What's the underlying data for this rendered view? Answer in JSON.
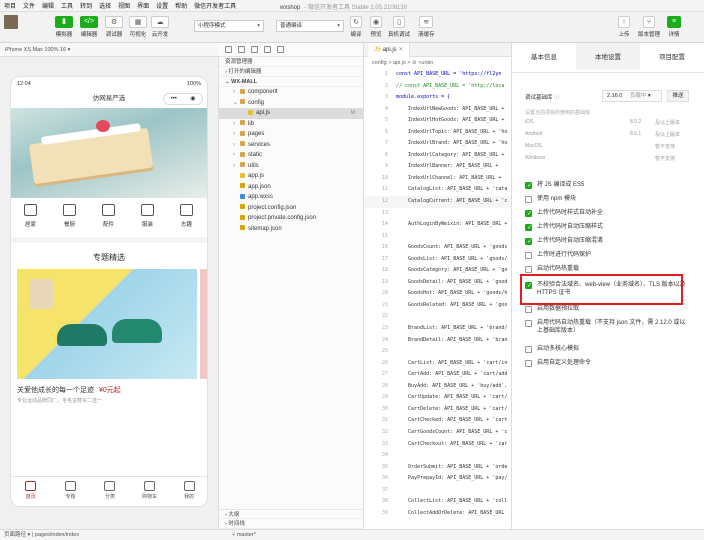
{
  "menu": [
    "项目",
    "文件",
    "编辑",
    "工具",
    "转到",
    "选择",
    "视图",
    "界面",
    "设置",
    "帮助",
    "微信开发者工具"
  ],
  "window_title": "wxshop",
  "window_subtitle": "- 微信开发者工具 Stable 1.05.2108130",
  "toolbar": {
    "simulator": "模拟器",
    "editor": "编辑器",
    "debugger": "调试器",
    "visual": "可视化",
    "cloud": "云开发",
    "mode": "小程序模式",
    "compile": "普通编译",
    "compile_btn": "编译",
    "preview": "预览",
    "real_debug": "真机调试",
    "clear_cache": "清缓存",
    "upload": "上传",
    "version": "版本管理",
    "details": "详情"
  },
  "sim": {
    "device": "iPhone XS Max 100% 16 ▾",
    "time": "12:04",
    "battery": "100%",
    "page_title": "仿网易严选",
    "capsule_dots": "•••",
    "capsule_target": "◉"
  },
  "categories": [
    "居家",
    "餐厨",
    "配件",
    "服装",
    "志趣"
  ],
  "topic": {
    "header": "专题精选",
    "title": "关爱他成长的每一个足迹",
    "price": "¥0元起",
    "desc": "专业运动品牌同厂，毛毛虫鞋买二送一"
  },
  "tabbar": [
    "首页",
    "专题",
    "分类",
    "购物车",
    "我的"
  ],
  "explorer": {
    "title": "资源管理器",
    "open_editors": "打开的编辑器",
    "project": "WX-MALL",
    "outline": "大纲",
    "timeline": "时间线",
    "items": [
      {
        "name": "component",
        "type": "folder",
        "indent": 1
      },
      {
        "name": "config",
        "type": "folder",
        "indent": 1
      },
      {
        "name": "api.js",
        "type": "js",
        "indent": 2,
        "badge": "M"
      },
      {
        "name": "lib",
        "type": "folder",
        "indent": 1
      },
      {
        "name": "pages",
        "type": "folder",
        "indent": 1
      },
      {
        "name": "services",
        "type": "folder",
        "indent": 1
      },
      {
        "name": "static",
        "type": "folder",
        "indent": 1
      },
      {
        "name": "utils",
        "type": "folder",
        "indent": 1
      },
      {
        "name": "app.js",
        "type": "js",
        "indent": 1
      },
      {
        "name": "app.json",
        "type": "json",
        "indent": 1
      },
      {
        "name": "app.wxss",
        "type": "wxss",
        "indent": 1
      },
      {
        "name": "project.config.json",
        "type": "json",
        "indent": 1
      },
      {
        "name": "project.private.config.json",
        "type": "json",
        "indent": 1
      },
      {
        "name": "sitemap.json",
        "type": "json",
        "indent": 1
      }
    ]
  },
  "editor": {
    "tab": "api.js",
    "breadcrumb": "config > api.js > ⊘ <unkn",
    "lines": [
      {
        "n": "1",
        "t": "const API_BASE_URL = 'https://fl2yn"
      },
      {
        "n": "2",
        "t": "// const API_BASE_URL = 'http://loca"
      },
      {
        "n": "3",
        "t": "module.exports = {"
      },
      {
        "n": "4",
        "t": "    IndexUrlNewGoods: API_BASE_URL +"
      },
      {
        "n": "5",
        "t": "    IndexUrlHotGoods: API_BASE_URL +"
      },
      {
        "n": "6",
        "t": "    IndexUrlTopic: API_BASE_URL + 'ho"
      },
      {
        "n": "7",
        "t": "    IndexUrlBrand: API_BASE_URL + 'ho"
      },
      {
        "n": "8",
        "t": "    IndexUrlCategory: API_BASE_URL +"
      },
      {
        "n": "9",
        "t": "    IndexUrlBanner: API_BASE_URL +"
      },
      {
        "n": "10",
        "t": "    IndexUrlChannel: API_BASE_URL +"
      },
      {
        "n": "11",
        "t": "    CatalogList: API_BASE_URL + 'cata"
      },
      {
        "n": "12",
        "t": "    CatalogCurrent: API_BASE_URL + 'c"
      },
      {
        "n": "13",
        "t": ""
      },
      {
        "n": "14",
        "t": "    AuthLoginByWeixin: API_BASE_URL +"
      },
      {
        "n": "15",
        "t": ""
      },
      {
        "n": "16",
        "t": "    GoodsCount: API_BASE_URL + 'goods"
      },
      {
        "n": "17",
        "t": "    GoodsList: API_BASE_URL + 'goods/"
      },
      {
        "n": "18",
        "t": "    GoodsCategory: API_BASE_URL + 'go"
      },
      {
        "n": "19",
        "t": "    GoodsDetail: API_BASE_URL + 'good"
      },
      {
        "n": "20",
        "t": "    GoodsHot: API_BASE_URL + 'goods/h"
      },
      {
        "n": "21",
        "t": "    GoodsRelated: API_BASE_URL + 'goo"
      },
      {
        "n": "22",
        "t": ""
      },
      {
        "n": "23",
        "t": "    BrandList: API_BASE_URL + 'brand/"
      },
      {
        "n": "24",
        "t": "    BrandDetail: API_BASE_URL + 'bran"
      },
      {
        "n": "25",
        "t": ""
      },
      {
        "n": "26",
        "t": "    CartList: API_BASE_URL + 'cart/in"
      },
      {
        "n": "27",
        "t": "    CartAdd: API_BASE_URL + 'cart/add"
      },
      {
        "n": "28",
        "t": "    BuyAdd: API_BASE_URL + 'buy/add',"
      },
      {
        "n": "29",
        "t": "    CartUpdate: API_BASE_URL + 'cart/"
      },
      {
        "n": "30",
        "t": "    CartDelete: API_BASE_URL + 'cart/"
      },
      {
        "n": "31",
        "t": "    CartChecked: API_BASE_URL + 'cart"
      },
      {
        "n": "32",
        "t": "    CartGoodsCount: API_BASE_URL + 'c"
      },
      {
        "n": "33",
        "t": "    CartCheckout: API_BASE_URL + 'car"
      },
      {
        "n": "34",
        "t": ""
      },
      {
        "n": "35",
        "t": "    OrderSubmit: API_BASE_URL + 'orde"
      },
      {
        "n": "36",
        "t": "    PayPrepayId: API_BASE_URL + 'pay/"
      },
      {
        "n": "37",
        "t": ""
      },
      {
        "n": "38",
        "t": "    CollectList: API_BASE_URL + 'coll"
      },
      {
        "n": "39",
        "t": "    CollectAddOrDelete: API_BASE_URL"
      }
    ]
  },
  "settings": {
    "tabs": [
      "基本信息",
      "本地设置",
      "项目配置"
    ],
    "lib_label": "调试基础库",
    "lib_version": "2.16.0",
    "lib_status": "负载中",
    "lib_push": "推送",
    "lib_desc": "设置当前项目所使用的基础库",
    "versions": [
      {
        "os": "iOS",
        "v": "8.0.2",
        "s": "及以上版本"
      },
      {
        "os": "Android",
        "v": "8.0.1",
        "s": "及以上版本"
      },
      {
        "os": "MacOS",
        "v": "",
        "s": "暂不支持"
      },
      {
        "os": "Windows",
        "v": "",
        "s": "暂不支持"
      }
    ],
    "checks": [
      {
        "label": "将 JS 编译成 ES5",
        "on": true
      },
      {
        "label": "使用 npm 模块",
        "on": false
      },
      {
        "label": "上传代码时样式自动补全",
        "on": true
      },
      {
        "label": "上传代码时自动压缩样式",
        "on": true
      },
      {
        "label": "上传代码时自动压缩混淆",
        "on": true
      },
      {
        "label": "上传时进行代码保护",
        "on": false
      },
      {
        "label": "启动代码热重载",
        "on": false
      },
      {
        "label": "不校验合法域名、web-view（业务域名）、TLS 版本以及 HTTPS 证书",
        "on": true
      },
      {
        "label": "启用数据预拉取",
        "on": false
      },
      {
        "label": "启用代码自动热重载（不支持 json 文件，需 2.12.0 或以上基础库版本）",
        "on": false
      },
      {
        "label": "启动多核心模拟",
        "on": false
      },
      {
        "label": "启用自定义处理命令",
        "on": false
      }
    ]
  },
  "statusbar": {
    "path": "页面路径 ▾  |  pages/index/index",
    "branch": "master*"
  },
  "colors": {
    "green": "#1aad19",
    "red": "#e02020",
    "brand": "#b4282d"
  }
}
